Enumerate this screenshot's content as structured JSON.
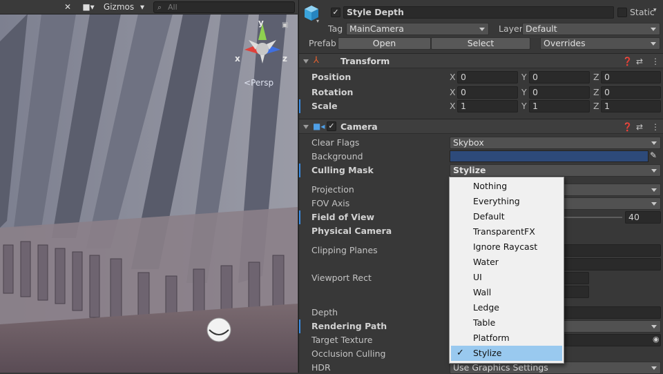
{
  "scene": {
    "toolbar": {
      "gizmos_label": "Gizmos",
      "search_placeholder": "All"
    },
    "gizmo": {
      "y": "y",
      "x": "x",
      "z": "z",
      "persp_label": "Persp"
    }
  },
  "inspector": {
    "object_name": "Style Depth",
    "static_label": "Static",
    "tag_label": "Tag",
    "tag_value": "MainCamera",
    "layer_label": "Layer",
    "layer_value": "Default",
    "prefab_label": "Prefab",
    "open_label": "Open",
    "select_label": "Select",
    "overrides_label": "Overrides"
  },
  "transform": {
    "title": "Transform",
    "position_label": "Position",
    "rotation_label": "Rotation",
    "scale_label": "Scale",
    "axis_x": "X",
    "axis_y": "Y",
    "axis_z": "Z",
    "position": [
      "0",
      "0",
      "0"
    ],
    "rotation": [
      "0",
      "0",
      "0"
    ],
    "scale": [
      "1",
      "1",
      "1"
    ]
  },
  "camera": {
    "title": "Camera",
    "clear_flags_label": "Clear Flags",
    "clear_flags_value": "Skybox",
    "background_label": "Background",
    "background_color": "#2d4a7a",
    "culling_mask_label": "Culling Mask",
    "culling_mask_value": "Stylize",
    "projection_label": "Projection",
    "fov_axis_label": "FOV Axis",
    "field_of_view_label": "Field of View",
    "field_of_view_value": "40",
    "physical_camera_label": "Physical Camera",
    "clipping_planes_label": "Clipping Planes",
    "viewport_rect_label": "Viewport Rect",
    "depth_label": "Depth",
    "rendering_path_label": "Rendering Path",
    "target_texture_label": "Target Texture",
    "occlusion_culling_label": "Occlusion Culling",
    "hdr_label": "HDR",
    "hdr_value": "Use Graphics Settings"
  },
  "layer_popup": {
    "items": [
      "Nothing",
      "Everything",
      "Default",
      "TransparentFX",
      "Ignore Raycast",
      "Water",
      "UI",
      "Wall",
      "Ledge",
      "Table",
      "Platform",
      "Stylize"
    ],
    "selected": "Stylize"
  },
  "colors": {
    "accent": "#3a8ee6",
    "selection": "#99c9ef"
  }
}
